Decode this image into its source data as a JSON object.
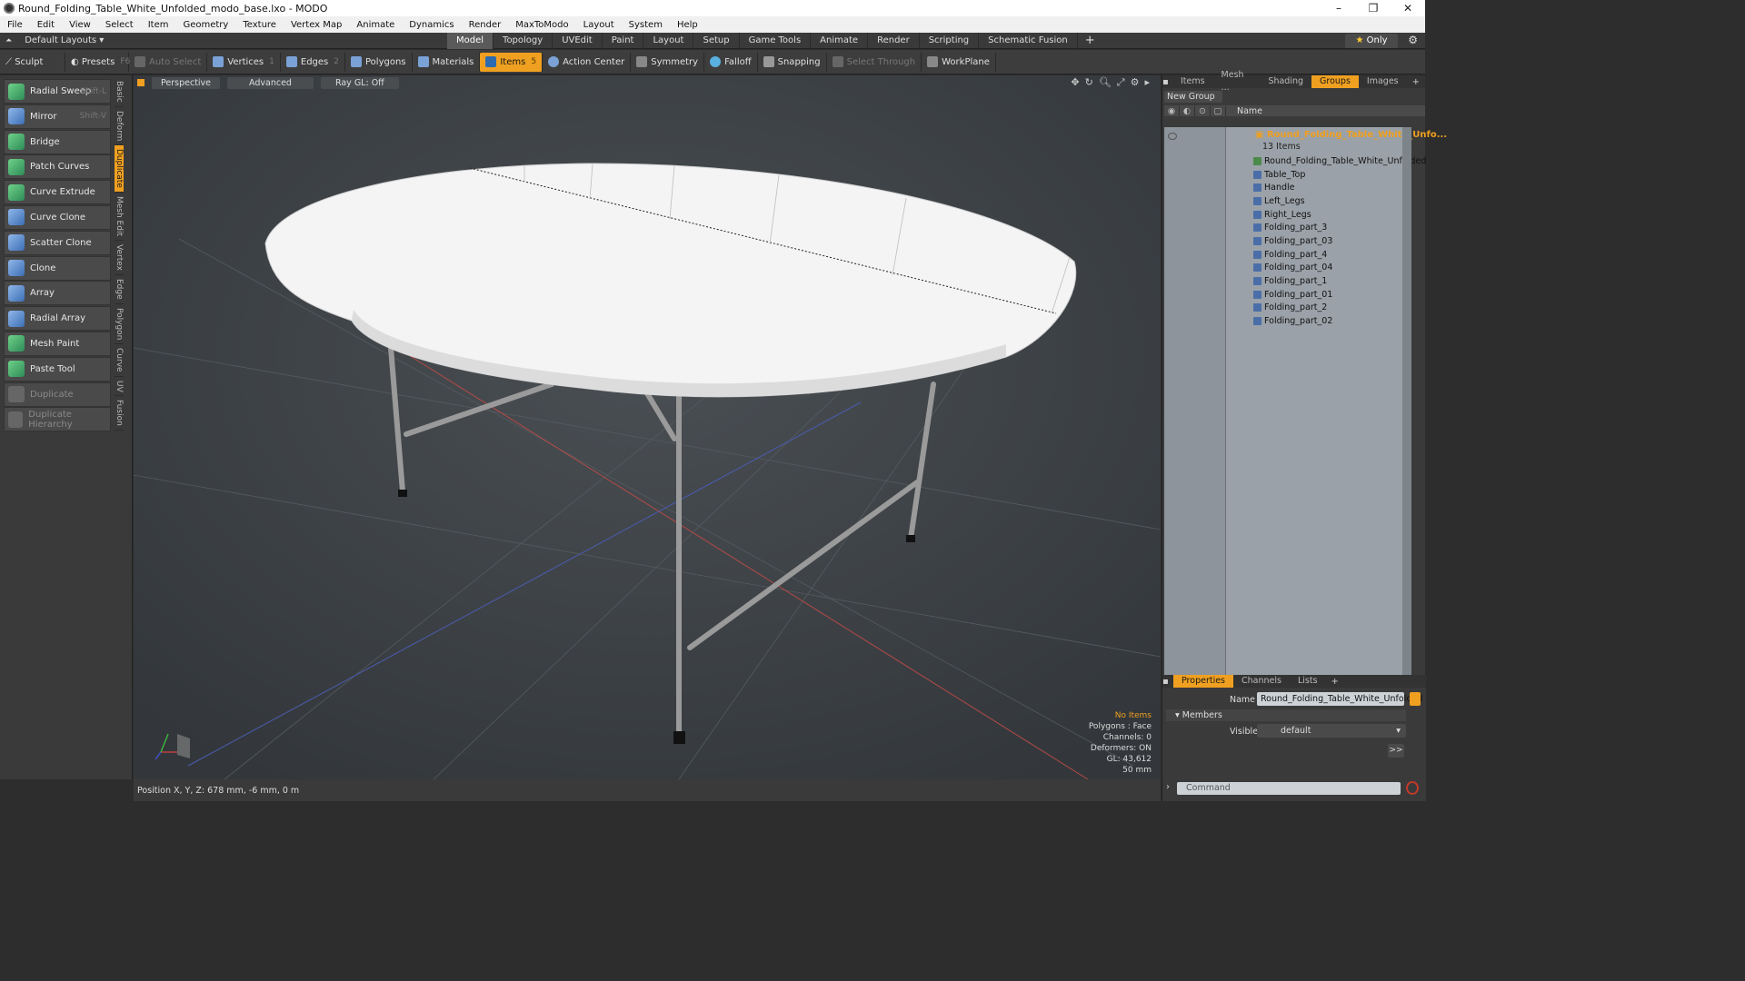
{
  "window": {
    "title": "Round_Folding_Table_White_Unfolded_modo_base.lxo - MODO",
    "min": "–",
    "max": "❐",
    "close": "✕"
  },
  "menu": [
    "File",
    "Edit",
    "View",
    "Select",
    "Item",
    "Geometry",
    "Texture",
    "Vertex Map",
    "Animate",
    "Dynamics",
    "Render",
    "MaxToModo",
    "Layout",
    "System",
    "Help"
  ],
  "layouts": {
    "label": "Default Layouts",
    "tabs": [
      "Model",
      "Topology",
      "UVEdit",
      "Paint",
      "Layout",
      "Setup",
      "Game Tools",
      "Animate",
      "Render",
      "Scripting",
      "Schematic Fusion"
    ],
    "active_tab": "Model",
    "plus": "+",
    "only": "Only",
    "star": "★"
  },
  "toolbar": {
    "sculpt": "Sculpt",
    "presets": "Presets",
    "presets_key": "F6",
    "auto_select": "Auto Select",
    "vertices": "Vertices",
    "vertices_n": "1",
    "edges": "Edges",
    "edges_n": "2",
    "polygons": "Polygons",
    "materials": "Materials",
    "items": "Items",
    "items_n": "5",
    "action_center": "Action Center",
    "symmetry": "Symmetry",
    "falloff": "Falloff",
    "snapping": "Snapping",
    "select_through": "Select Through",
    "workplane": "WorkPlane"
  },
  "tools": [
    {
      "label": "Radial Sweep",
      "shortcut": "Shift-L"
    },
    {
      "label": "Mirror",
      "shortcut": "Shift-V"
    },
    {
      "label": "Bridge",
      "shortcut": ""
    },
    {
      "label": "Patch Curves",
      "shortcut": ""
    },
    {
      "label": "Curve Extrude",
      "shortcut": ""
    },
    {
      "label": "Curve Clone",
      "shortcut": ""
    },
    {
      "label": "Scatter Clone",
      "shortcut": ""
    },
    {
      "label": "Clone",
      "shortcut": ""
    },
    {
      "label": "Array",
      "shortcut": ""
    },
    {
      "label": "Radial Array",
      "shortcut": ""
    },
    {
      "label": "Mesh Paint",
      "shortcut": ""
    },
    {
      "label": "Paste Tool",
      "shortcut": ""
    },
    {
      "label": "Duplicate",
      "shortcut": ""
    },
    {
      "label": "Duplicate Hierarchy",
      "shortcut": ""
    }
  ],
  "vtabs": [
    "Basic",
    "Deform",
    "Duplicate",
    "Mesh Edit",
    "Vertex",
    "Edge",
    "Polygon",
    "Curve",
    "UV",
    "Fusion"
  ],
  "viewport": {
    "view": "Perspective",
    "mode": "Advanced",
    "raygl": "Ray GL: Off",
    "info": {
      "no_items": "No Items",
      "polygons": "Polygons : Face",
      "channels": "Channels: 0",
      "deformers": "Deformers: ON",
      "gl": "GL: 43,612",
      "scale": "50 mm"
    }
  },
  "status": {
    "position": "Position X, Y, Z:   678 mm, -6 mm, 0 m"
  },
  "right": {
    "tabs": [
      "Items",
      "Mesh ...",
      "Shading",
      "Groups",
      "Images"
    ],
    "active_tab": "Groups",
    "new_group": "New Group",
    "name_header": "Name",
    "group_name": "Round_Folding_Table_White_Unfo...",
    "group_count": "13 Items",
    "items": [
      "Round_Folding_Table_White_Unfolded",
      "Table_Top",
      "Handle",
      "Left_Legs",
      "Right_Legs",
      "Folding_part_3",
      "Folding_part_03",
      "Folding_part_4",
      "Folding_part_04",
      "Folding_part_1",
      "Folding_part_01",
      "Folding_part_2",
      "Folding_part_02"
    ],
    "prop_tabs": [
      "Properties",
      "Channels",
      "Lists"
    ],
    "prop_active": "Properties",
    "name_label": "Name",
    "name_value": "Round_Folding_Table_White_Unfolded",
    "members": "Members",
    "visible_label": "Visible",
    "visible_value": "default",
    "expand": ">>",
    "command_placeholder": "Command"
  }
}
